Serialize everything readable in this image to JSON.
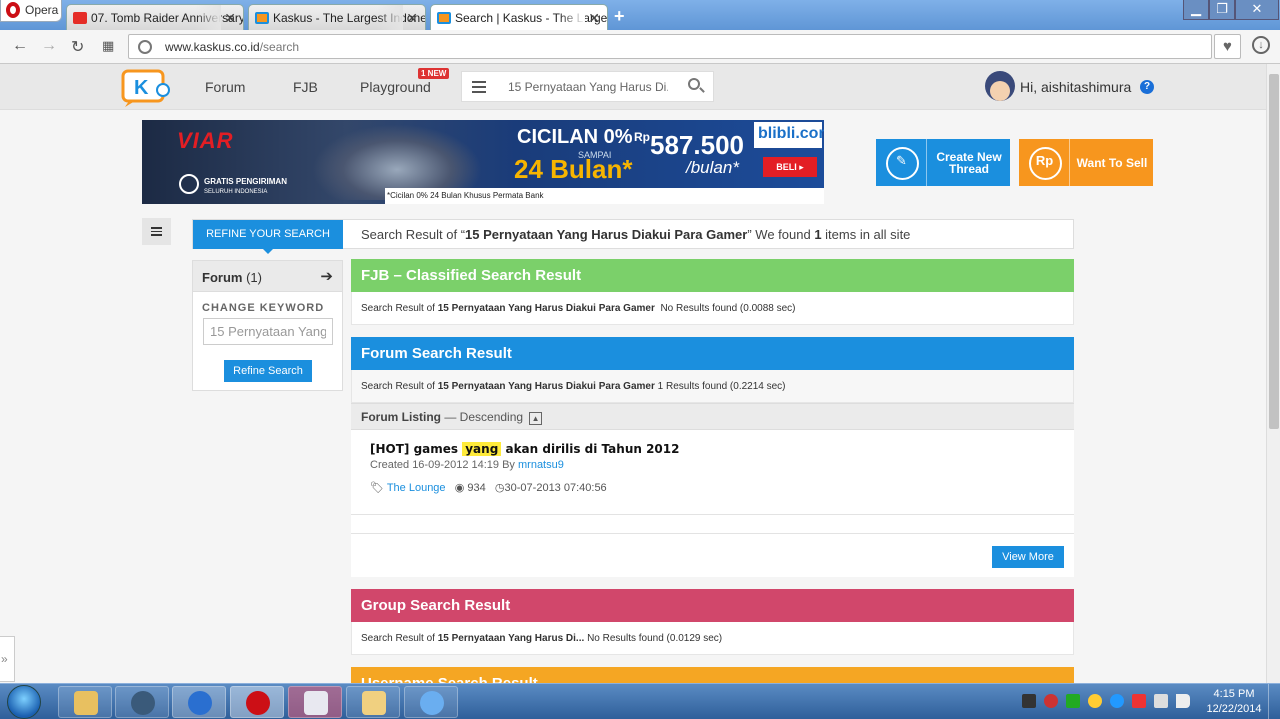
{
  "browser": {
    "menu_label": "Opera",
    "tabs": [
      {
        "title": "07. Tomb Raider Anniversary",
        "favicon": "youtube-icon",
        "active": false
      },
      {
        "title": "Kaskus - The Largest Indonesian Community",
        "favicon": "kaskus-icon",
        "active": false
      },
      {
        "title": "Search | Kaskus - The Largest",
        "favicon": "kaskus-icon",
        "active": true
      }
    ],
    "address": {
      "domain": "www.kaskus.co.id",
      "path": "/search"
    }
  },
  "site": {
    "nav": {
      "forum": "Forum",
      "fjb": "FJB",
      "playground": "Playground",
      "new_badge": "1 NEW"
    },
    "search_query": "15 Pernyataan Yang Harus Di...",
    "greeting": "Hi, aishitashimura",
    "help": "?"
  },
  "banner": {
    "brand": "VIAR",
    "headline": "CICILAN 0%",
    "currency": "Rp",
    "price": "587.500",
    "sampai": "SAMPAI",
    "duration": "24 Bulan*",
    "per_month": "/bulan*",
    "store": "blibli.com",
    "cta": "BELI ▸",
    "shipping_title": "GRATIS PENGIRIMAN",
    "shipping_sub": "SELURUH INDONESIA",
    "footnote": "*Cicilan 0% 24 Bulan Khusus Permata Bank"
  },
  "actions": {
    "create_thread": "Create New Thread",
    "want_to_sell": "Want To Sell",
    "sell_icon_text": "Rp"
  },
  "refine": {
    "tab_label": "REFINE YOUR SEARCH",
    "summary_prefix": "Search Result of “",
    "query": "15 Pernyataan Yang Harus Diakui Para Gamer",
    "summary_mid": "” We found ",
    "count": "1",
    "summary_suffix": " items in all site"
  },
  "sidebar": {
    "forum_label": "Forum",
    "forum_count": "(1)",
    "change_keyword": "CHANGE KEYWORD",
    "keyword_value": "15 Pernyataan Yang",
    "refine_button": "Refine Search"
  },
  "sections": {
    "fjb": {
      "title": "FJB – Classified Search Result",
      "prefix": "Search Result of ",
      "query": "15 Pernyataan Yang Harus Diakui Para Gamer",
      "status": "No Results found (0.0088 sec)",
      "color": "#7bd06a"
    },
    "forum": {
      "title": "Forum Search Result",
      "prefix": "Search Result of ",
      "query": "15 Pernyataan Yang Harus Diakui Para Gamer",
      "status": "1 Results found (0.2214 sec)",
      "listing_label": "Forum Listing",
      "listing_order": "— Descending",
      "color": "#1b8fde",
      "thread": {
        "title_before": "[HOT] games ",
        "title_highlight": "yang",
        "title_after": " akan dirilis di Tahun 2012",
        "created": "Created 16-09-2012 14:19 By ",
        "author": "mrnatsu9",
        "category": "The Lounge",
        "views": "934",
        "last_post": "30-07-2013 07:40:56"
      },
      "view_more": "View More"
    },
    "group": {
      "title": "Group Search Result",
      "prefix": "Search Result of ",
      "query": "15 Pernyataan Yang Harus Di...",
      "status": "No Results found (0.0129 sec)",
      "color": "#d1476b"
    },
    "username": {
      "title": "Username Search Result",
      "color": "#f5a623"
    }
  },
  "taskbar": {
    "time": "4:15 PM",
    "date": "12/22/2014"
  }
}
